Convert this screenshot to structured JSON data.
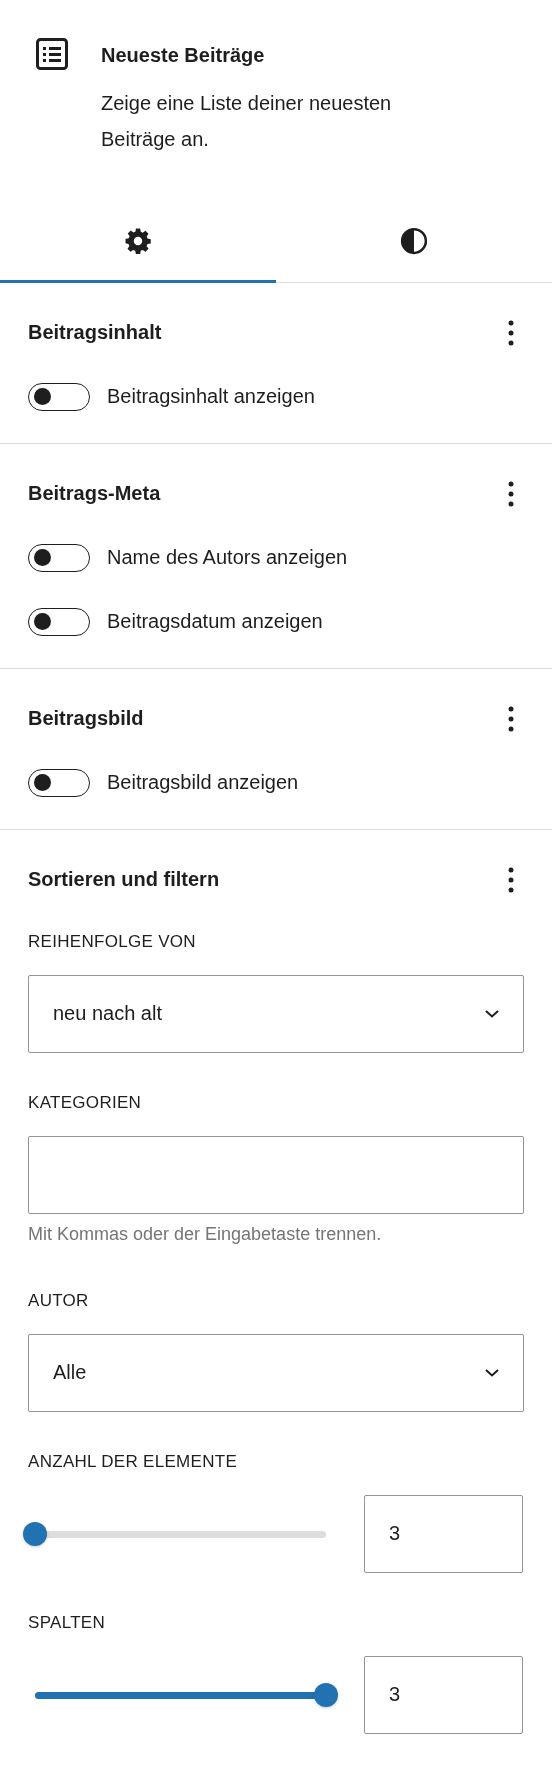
{
  "block": {
    "title": "Neueste Beiträge",
    "description": "Zeige eine Liste deiner neuesten Beiträge an."
  },
  "tabs": [
    {
      "kind": "settings",
      "selected": true
    },
    {
      "kind": "styles",
      "selected": false
    }
  ],
  "panels": [
    {
      "title": "Beitragsinhalt",
      "toggles": [
        {
          "label": "Beitragsinhalt anzeigen",
          "on": false
        }
      ]
    },
    {
      "title": "Beitrags-Meta",
      "toggles": [
        {
          "label": "Name des Autors anzeigen",
          "on": false
        },
        {
          "label": "Beitragsdatum anzeigen",
          "on": false
        }
      ]
    },
    {
      "title": "Beitragsbild",
      "toggles": [
        {
          "label": "Beitragsbild anzeigen",
          "on": false
        }
      ]
    },
    {
      "title": "Sortieren und filtern",
      "controls": [
        {
          "kind": "select",
          "label": "REIHENFOLGE VON",
          "value": "neu nach alt"
        },
        {
          "kind": "text",
          "label": "KATEGORIEN",
          "help": "Mit Kommas oder der Eingabetaste trennen."
        },
        {
          "kind": "select",
          "label": "AUTOR",
          "value": "Alle"
        },
        {
          "kind": "range",
          "label": "ANZAHL DER ELEMENTE",
          "level": 0,
          "value": "3"
        },
        {
          "kind": "range",
          "label": "SPALTEN",
          "level": 1,
          "value": "3"
        }
      ]
    }
  ]
}
